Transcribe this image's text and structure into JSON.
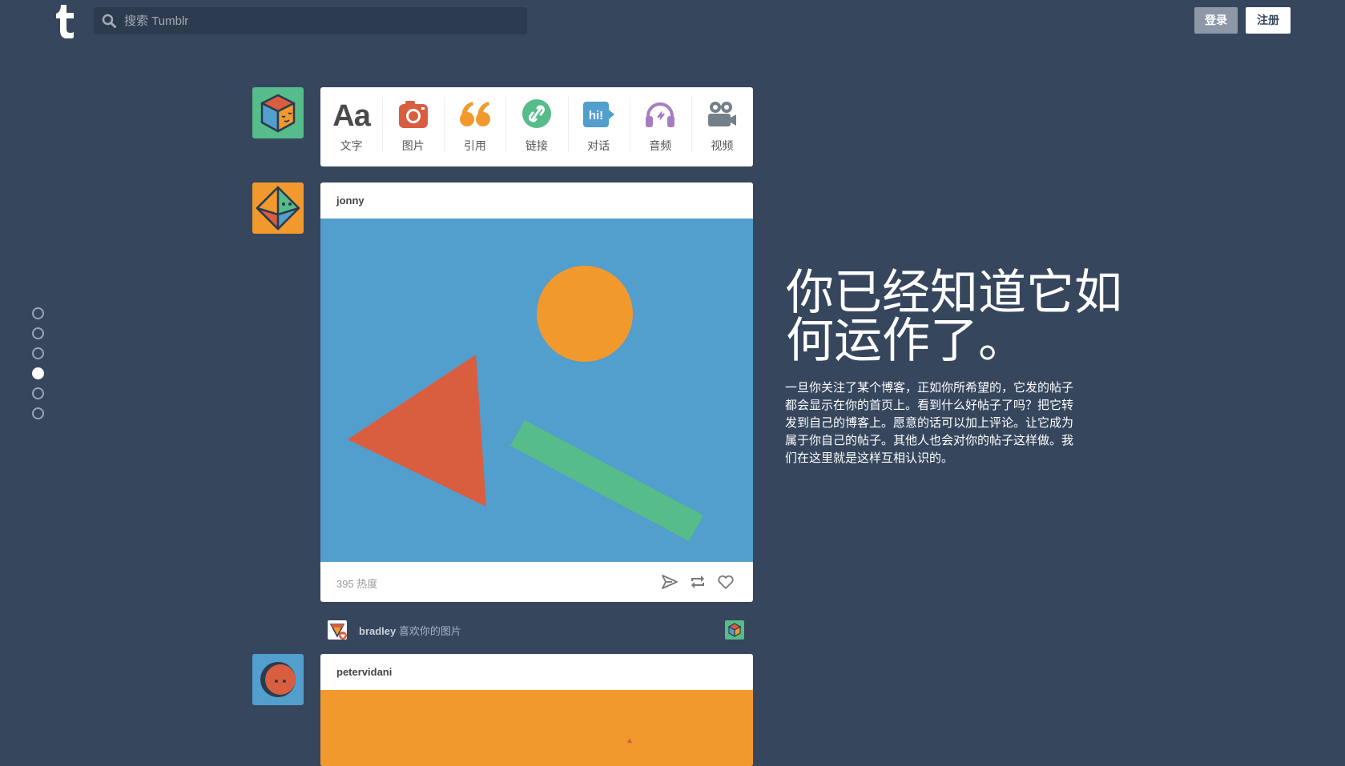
{
  "header": {
    "logo_alt": "t",
    "search_placeholder": "搜索 Tumblr",
    "login_label": "登录",
    "signup_label": "注册"
  },
  "composer": {
    "types": [
      {
        "label": "文字",
        "icon": "text-icon",
        "color": "#444444"
      },
      {
        "label": "图片",
        "icon": "camera-icon",
        "color": "#d95e40"
      },
      {
        "label": "引用",
        "icon": "quote-icon",
        "color": "#f2992e"
      },
      {
        "label": "链接",
        "icon": "link-icon",
        "color": "#56bc8a"
      },
      {
        "label": "对话",
        "icon": "chat-icon",
        "color": "#529ecc"
      },
      {
        "label": "音频",
        "icon": "headphones-icon",
        "color": "#a77dc2"
      },
      {
        "label": "视频",
        "icon": "video-camera-icon",
        "color": "#748089"
      }
    ],
    "text_glyph": "Aa",
    "chat_glyph": "hi!"
  },
  "post1": {
    "author": "jonny",
    "notes": "395 热度"
  },
  "notification": {
    "user": "bradley",
    "text": "喜欢你的图片"
  },
  "post2": {
    "author": "petervidani"
  },
  "sidebar_dots": {
    "count": 6,
    "active_index": 3
  },
  "headline": "你已经知道它如何运作了。",
  "description": "一旦你关注了某个博客，正如你所希望的，它发的帖子都会显示在你的首页上。看到什么好帖子了吗？把它转发到自己的博客上。愿意的话可以加上评论。让它成为属于你自己的帖子。其他人也会对你的帖子这样做。我们在这里就是这样互相认识的。",
  "colors": {
    "background": "#36465d",
    "image_blue": "#529ecc",
    "orange": "#f2992e",
    "red": "#d95e40",
    "green": "#56bc8a"
  }
}
